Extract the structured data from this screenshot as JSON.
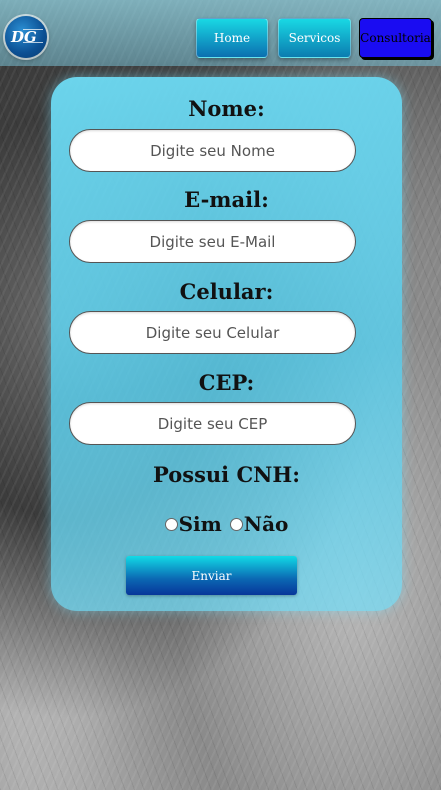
{
  "header": {
    "logo_text": "DG",
    "nav": {
      "home": "Home",
      "servicos": "Servicos",
      "consultoria": "Consultoria"
    }
  },
  "form": {
    "nome": {
      "label": "Nome:",
      "placeholder": "Digite seu Nome"
    },
    "email": {
      "label": "E-mail:",
      "placeholder": "Digite seu E-Mail"
    },
    "celular": {
      "label": "Celular:",
      "placeholder": "Digite seu Celular"
    },
    "cep": {
      "label": "CEP:",
      "placeholder": "Digite seu CEP"
    },
    "cnh": {
      "label": "Possui CNH:",
      "option_sim": "Sim",
      "option_nao": "Não"
    },
    "submit_label": "Enviar"
  },
  "colors": {
    "card": "#6edcf5",
    "button_gradient_top": "#12dbe6",
    "button_gradient_bottom": "#07369a",
    "consultoria_button": "#1a0cf2"
  }
}
